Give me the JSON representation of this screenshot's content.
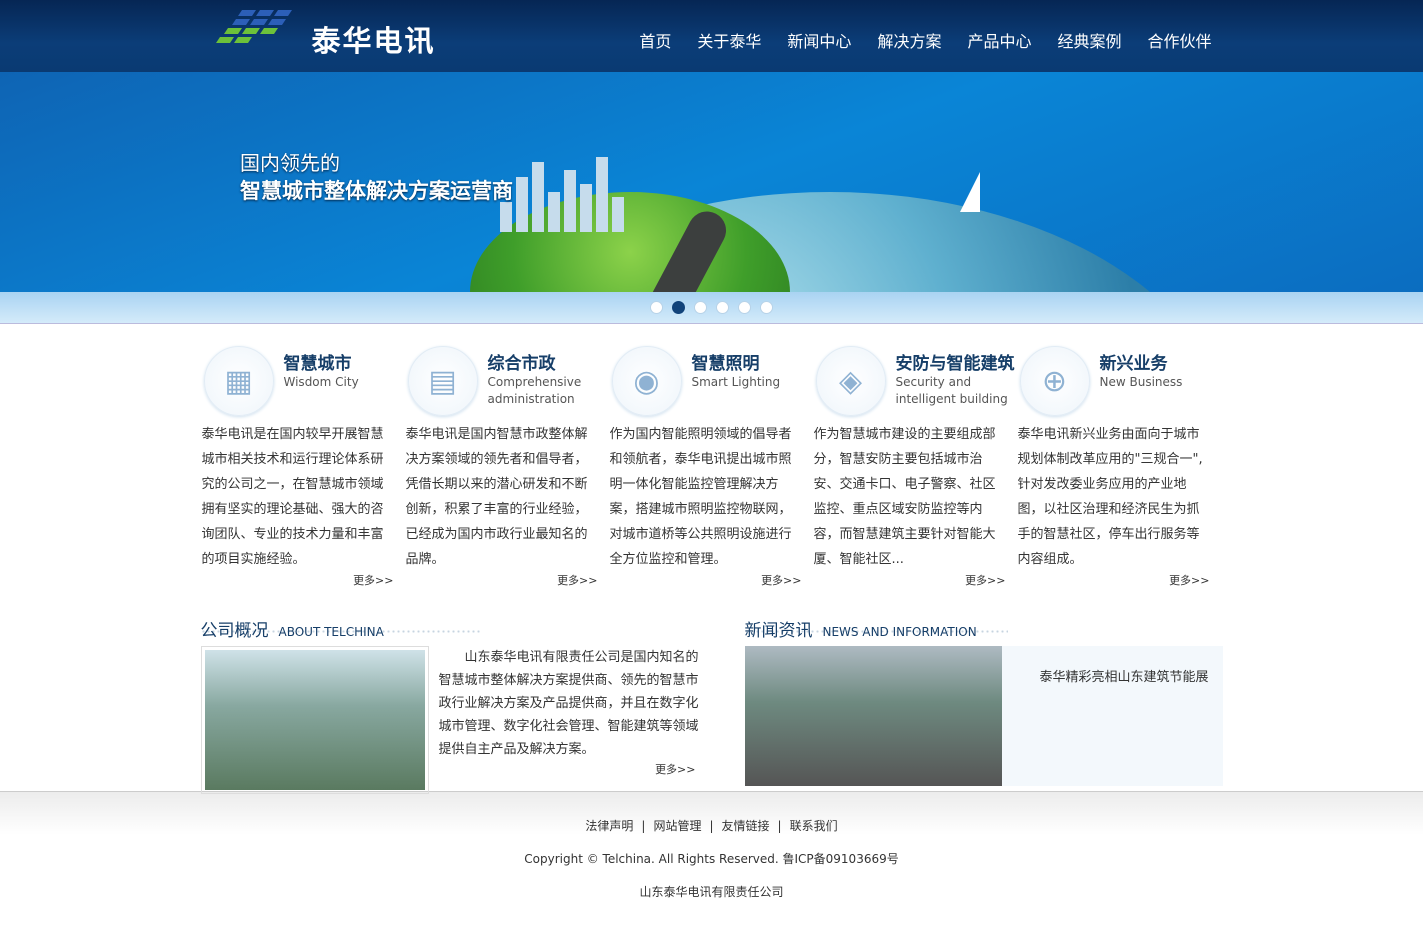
{
  "header": {
    "logo_text": "泰华电讯",
    "nav": [
      "首页",
      "关于泰华",
      "新闻中心",
      "解决方案",
      "产品中心",
      "经典案例",
      "合作伙伴"
    ]
  },
  "banner": {
    "line1": "国内领先的",
    "line2": "智慧城市整体解决方案运营商",
    "slides": 6,
    "active": 1
  },
  "services": [
    {
      "title": "智慧城市",
      "en": "Wisdom City",
      "icon": "building-icon",
      "desc": "泰华电讯是在国内较早开展智慧城市相关技术和运行理论体系研究的公司之一，在智慧城市领域拥有坚实的理论基础、强大的咨询团队、专业的技术力量和丰富的项目实施经验。",
      "more": "更多>>"
    },
    {
      "title": "综合市政",
      "en": "Comprehensive administration",
      "icon": "document-icon",
      "desc": "泰华电讯是国内智慧市政整体解决方案领域的领先者和倡导者，凭借长期以来的潜心研发和不断创新，积累了丰富的行业经验，已经成为国内市政行业最知名的品牌。",
      "more": "更多>>"
    },
    {
      "title": "智慧照明",
      "en": "Smart Lighting",
      "icon": "lightbulb-icon",
      "desc": "作为国内智能照明领域的倡导者和领航者，泰华电讯提出城市照明一体化智能监控管理解决方案，搭建城市照明监控物联网，对城市道桥等公共照明设施进行全方位监控和管理。",
      "more": "更多>>"
    },
    {
      "title": "安防与智能建筑",
      "en": "Security and intelligent building",
      "icon": "layers-icon",
      "desc": "作为智慧城市建设的主要组成部分，智慧安防主要包括城市治安、交通卡口、电子警察、社区监控、重点区域安防监控等内容，而智慧建筑主要针对智能大厦、智能社区...",
      "more": "更多>>"
    },
    {
      "title": "新兴业务",
      "en": "New Business",
      "icon": "globe-search-icon",
      "desc": "泰华电讯新兴业务由面向于城市规划体制改革应用的\"三规合一\",针对发改委业务应用的产业地图，以社区治理和经济民生为抓手的智慧社区，停车出行服务等内容组成。",
      "more": "更多>>"
    }
  ],
  "about": {
    "title": "公司概况",
    "en": "ABOUT TELCHINA",
    "text": "山东泰华电讯有限责任公司是国内知名的智慧城市整体解决方案提供商、领先的智慧市政行业解决方案及产品提供商，并且在数字化城市管理、数字化社会管理、智能建筑等领域提供自主产品及解决方案。",
    "more": "更多>>"
  },
  "news": {
    "title": "新闻资讯",
    "en": "NEWS AND INFORMATION",
    "item": "泰华精彩亮相山东建筑节能展"
  },
  "footer": {
    "links": [
      "法律声明",
      "网站管理",
      "友情链接",
      "联系我们"
    ],
    "copyright": "Copyright © Telchina. All Rights Reserved. 鲁ICP备09103669号",
    "company": "山东泰华电讯有限责任公司"
  }
}
